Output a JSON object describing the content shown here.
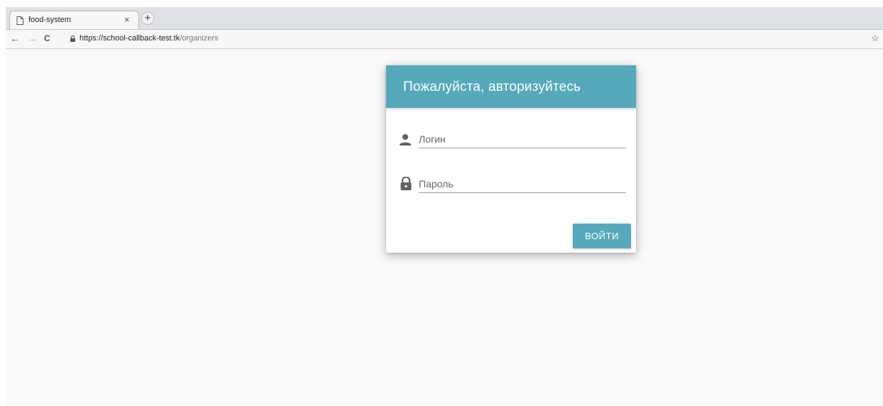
{
  "browser": {
    "tab": {
      "title": "food-system",
      "close_glyph": "×",
      "icon": "document-icon"
    },
    "new_tab_glyph": "+",
    "nav": {
      "back_glyph": "←",
      "forward_glyph": "→",
      "reload_glyph": "C"
    },
    "url": {
      "host": "https://school-callback-test.tk",
      "path": "/organizers"
    },
    "bookmark_glyph": "☆"
  },
  "login": {
    "title": "Пожалуйста, авторизуйтесь",
    "username": {
      "placeholder": "Логин",
      "value": "",
      "icon": "person-icon"
    },
    "password": {
      "placeholder": "Пароль",
      "value": "",
      "icon": "lock-icon"
    },
    "submit_label": "ВОЙТИ"
  },
  "colors": {
    "accent": "#56a9bb",
    "page_background": "#fafafa"
  }
}
